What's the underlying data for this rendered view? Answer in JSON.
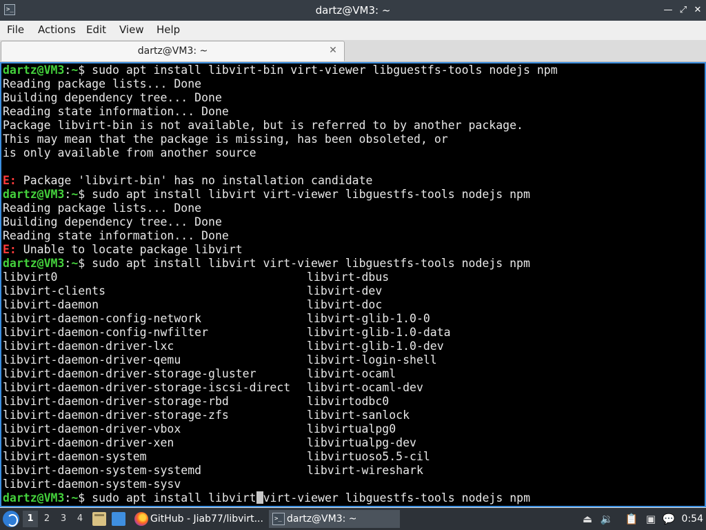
{
  "window": {
    "title": "dartz@VM3: ~",
    "icon": "terminal-icon",
    "controls": {
      "minimize": "—",
      "restore": "⤢",
      "close": "✕"
    }
  },
  "menu": [
    "File",
    "Actions",
    "Edit",
    "View",
    "Help"
  ],
  "tab": {
    "label": "dartz@VM3: ~",
    "close": "✕"
  },
  "terminal": {
    "prompt": "dartz@VM3",
    "cwd": "~",
    "lines": [
      {
        "type": "cmd",
        "text": "sudo apt install libvirt-bin virt-viewer libguestfs-tools nodejs npm"
      },
      {
        "type": "out",
        "text": "Reading package lists... Done"
      },
      {
        "type": "out",
        "text": "Building dependency tree... Done"
      },
      {
        "type": "out",
        "text": "Reading state information... Done"
      },
      {
        "type": "out",
        "text": "Package libvirt-bin is not available, but is referred to by another package."
      },
      {
        "type": "out",
        "text": "This may mean that the package is missing, has been obsoleted, or"
      },
      {
        "type": "out",
        "text": "is only available from another source"
      },
      {
        "type": "out",
        "text": ""
      },
      {
        "type": "err",
        "label": "E:",
        "text": " Package 'libvirt-bin' has no installation candidate"
      },
      {
        "type": "cmd",
        "text": "sudo apt install libvirt virt-viewer libguestfs-tools nodejs npm"
      },
      {
        "type": "out",
        "text": "Reading package lists... Done"
      },
      {
        "type": "out",
        "text": "Building dependency tree... Done"
      },
      {
        "type": "out",
        "text": "Reading state information... Done"
      },
      {
        "type": "err",
        "label": "E:",
        "text": " Unable to locate package libvirt"
      },
      {
        "type": "cmd",
        "text": "sudo apt install libvirt virt-viewer libguestfs-tools nodejs npm"
      },
      {
        "type": "cols",
        "left": "libvirt0",
        "right": "libvirt-dbus"
      },
      {
        "type": "cols",
        "left": "libvirt-clients",
        "right": "libvirt-dev"
      },
      {
        "type": "cols",
        "left": "libvirt-daemon",
        "right": "libvirt-doc"
      },
      {
        "type": "cols",
        "left": "libvirt-daemon-config-network",
        "right": "libvirt-glib-1.0-0"
      },
      {
        "type": "cols",
        "left": "libvirt-daemon-config-nwfilter",
        "right": "libvirt-glib-1.0-data"
      },
      {
        "type": "cols",
        "left": "libvirt-daemon-driver-lxc",
        "right": "libvirt-glib-1.0-dev"
      },
      {
        "type": "cols",
        "left": "libvirt-daemon-driver-qemu",
        "right": "libvirt-login-shell"
      },
      {
        "type": "cols",
        "left": "libvirt-daemon-driver-storage-gluster",
        "right": "libvirt-ocaml"
      },
      {
        "type": "cols",
        "left": "libvirt-daemon-driver-storage-iscsi-direct",
        "right": "libvirt-ocaml-dev"
      },
      {
        "type": "cols",
        "left": "libvirt-daemon-driver-storage-rbd",
        "right": "libvirtodbc0"
      },
      {
        "type": "cols",
        "left": "libvirt-daemon-driver-storage-zfs",
        "right": "libvirt-sanlock"
      },
      {
        "type": "cols",
        "left": "libvirt-daemon-driver-vbox",
        "right": "libvirtualpg0"
      },
      {
        "type": "cols",
        "left": "libvirt-daemon-driver-xen",
        "right": "libvirtualpg-dev"
      },
      {
        "type": "cols",
        "left": "libvirt-daemon-system",
        "right": "libvirtuoso5.5-cil"
      },
      {
        "type": "cols",
        "left": "libvirt-daemon-system-systemd",
        "right": "libvirt-wireshark"
      },
      {
        "type": "out",
        "text": "libvirt-daemon-system-sysv"
      },
      {
        "type": "cmd",
        "text": "sudo apt install libvirt",
        "after": "virt-viewer libguestfs-tools nodejs npm",
        "cursor": true
      }
    ]
  },
  "taskbar": {
    "start_icon": "debian-menu-icon",
    "workspaces": [
      "1",
      "2",
      "3",
      "4"
    ],
    "active_workspace": "1",
    "launchers": [
      "file-manager-icon",
      "show-desktop-icon"
    ],
    "tasks": [
      {
        "label": "GitHub - Jiab77/libvirt...",
        "icon": "firefox-icon",
        "active": false
      },
      {
        "label": "dartz@VM3: ~",
        "icon": "terminal-icon",
        "active": true
      }
    ],
    "tray_icons": [
      "eject-icon",
      "volume-icon",
      "clipboard-icon",
      "network-icon",
      "notification-icon"
    ],
    "clock": "0:54"
  }
}
